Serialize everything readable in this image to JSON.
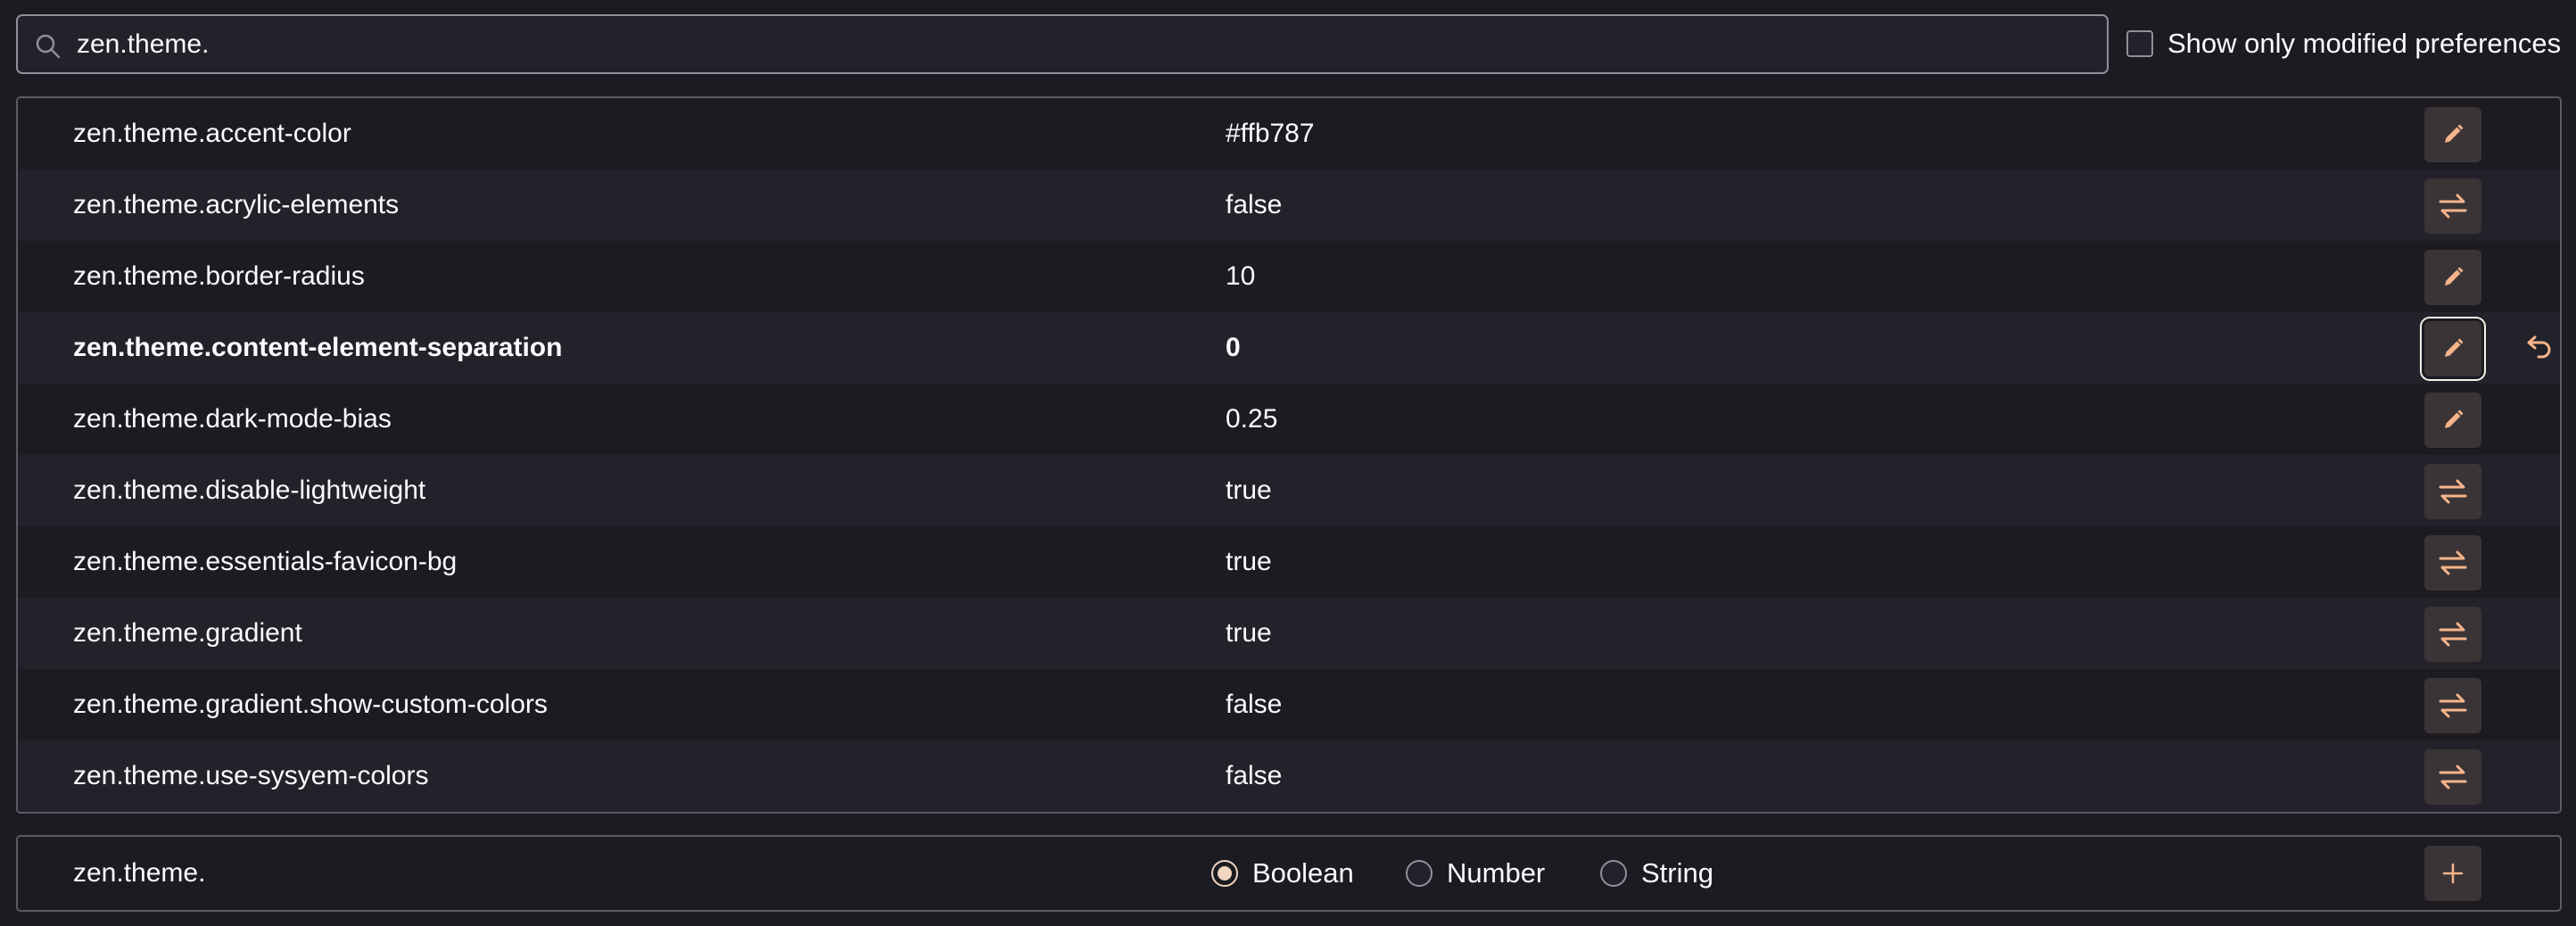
{
  "search": {
    "value": "zen.theme.",
    "icon": "search-icon"
  },
  "filter": {
    "label": "Show only modified preferences",
    "checked": false
  },
  "preferences": [
    {
      "name": "zen.theme.accent-color",
      "value": "#ffb787",
      "action": "edit"
    },
    {
      "name": "zen.theme.acrylic-elements",
      "value": "false",
      "action": "toggle"
    },
    {
      "name": "zen.theme.border-radius",
      "value": "10",
      "action": "edit"
    },
    {
      "name": "zen.theme.content-element-separation",
      "value": "0",
      "action": "edit",
      "modified": true
    },
    {
      "name": "zen.theme.dark-mode-bias",
      "value": "0.25",
      "action": "edit"
    },
    {
      "name": "zen.theme.disable-lightweight",
      "value": "true",
      "action": "toggle"
    },
    {
      "name": "zen.theme.essentials-favicon-bg",
      "value": "true",
      "action": "toggle"
    },
    {
      "name": "zen.theme.gradient",
      "value": "true",
      "action": "toggle"
    },
    {
      "name": "zen.theme.gradient.show-custom-colors",
      "value": "false",
      "action": "toggle"
    },
    {
      "name": "zen.theme.use-sysyem-colors",
      "value": "false",
      "action": "toggle"
    }
  ],
  "new_pref": {
    "name": "zen.theme.",
    "types": [
      {
        "label": "Boolean",
        "checked": true
      },
      {
        "label": "Number",
        "checked": false
      },
      {
        "label": "String",
        "checked": false
      }
    ]
  },
  "colors": {
    "background": "#1c1b22",
    "row_alt": "#23222b",
    "accent": "#f7b48a",
    "button_bg": "#3a3437"
  }
}
